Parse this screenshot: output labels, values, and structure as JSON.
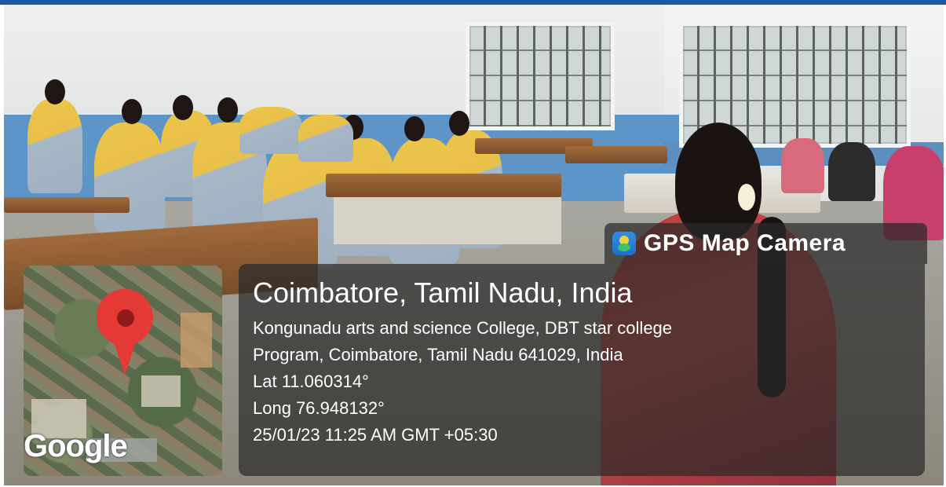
{
  "overlay": {
    "app_name": "GPS Map Camera",
    "city": "Coimbatore, Tamil Nadu, India",
    "address_line1": "Kongunadu arts and science College, DBT star college",
    "address_line2": "Program, Coimbatore, Tamil Nadu 641029, India",
    "latitude": "Lat 11.060314°",
    "longitude": "Long 76.948132°",
    "timestamp": "25/01/23 11:25 AM GMT +05:30"
  },
  "map": {
    "logo_text": "Google",
    "pin_icon": "location-pin-icon"
  },
  "colors": {
    "top_bar": "#1c57a8",
    "pin": "#e53935"
  }
}
